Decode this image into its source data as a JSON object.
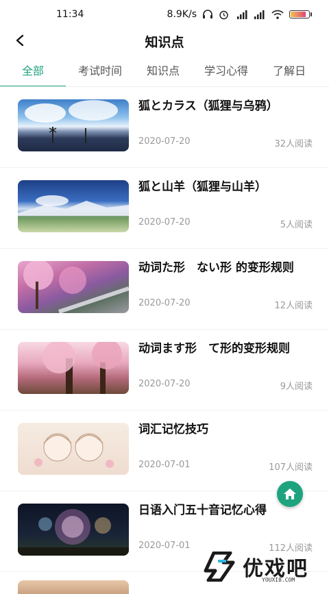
{
  "status_bar": {
    "time": "11:34",
    "network_speed": "8.9K/s"
  },
  "header": {
    "title": "知识点",
    "back_icon": "chevron-left-icon"
  },
  "tabs": [
    {
      "label": "全部",
      "active": true
    },
    {
      "label": "考试时间",
      "active": false
    },
    {
      "label": "知识点",
      "active": false
    },
    {
      "label": "学习心得",
      "active": false
    },
    {
      "label": "了解日",
      "active": false
    }
  ],
  "articles": [
    {
      "title": "狐とカラス（狐狸与乌鸦）",
      "date": "2020-07-20",
      "reads": "32人阅读"
    },
    {
      "title": "狐と山羊（狐狸与山羊）",
      "date": "2020-07-20",
      "reads": "5人阅读"
    },
    {
      "title": "动词た形　ない形 的变形规则",
      "date": "2020-07-20",
      "reads": "12人阅读"
    },
    {
      "title": "动词ます形　て形的变形规则",
      "date": "2020-07-20",
      "reads": "9人阅读"
    },
    {
      "title": "词汇记忆技巧",
      "date": "2020-07-01",
      "reads": "107人阅读"
    },
    {
      "title": "日语入门五十音记忆心得",
      "date": "2020-07-01",
      "reads": "112人阅读"
    }
  ],
  "fab": {
    "icon": "home-icon"
  },
  "watermark": {
    "text": "优戏吧",
    "url": "YOUXI8.COM"
  },
  "colors": {
    "accent": "#1fa37f"
  }
}
